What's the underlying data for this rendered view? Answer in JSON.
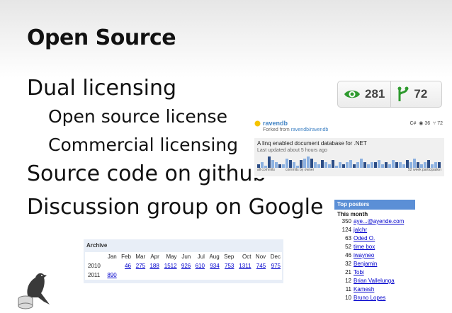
{
  "slide": {
    "title": "Open Source",
    "bullets": [
      {
        "text": "Dual licensing",
        "level": 1
      },
      {
        "text": "Open source license",
        "level": 2
      },
      {
        "text": "Commercial licensing",
        "level": 2
      },
      {
        "text": "Source code on github",
        "level": 1
      },
      {
        "text": "Discussion group on Google",
        "level": 1
      }
    ]
  },
  "badge": {
    "watchers": "281",
    "forks": "72",
    "watch_icon": "eye-icon",
    "fork_icon": "fork-icon",
    "accent": "#2e9a2e"
  },
  "repo": {
    "name": "ravendb",
    "forked_prefix": "Forked from ",
    "forked_from": "ravendb/ravendb",
    "lang": "C#",
    "watchers": "36",
    "forks": "72",
    "description": "A linq enabled document database for .NET",
    "updated": "Last updated about 5 hours ago",
    "graph_left": "all commits",
    "graph_mid": "commits by owner",
    "graph_right": "52 week participation",
    "participation": [
      2,
      3,
      1,
      6,
      4,
      3,
      2,
      2,
      5,
      4,
      3,
      1,
      4,
      5,
      6,
      5,
      3,
      2,
      4,
      3,
      2,
      4,
      1,
      3,
      2,
      3,
      4,
      2,
      3,
      5,
      3,
      2,
      3,
      3,
      4,
      2,
      3,
      2,
      4,
      3,
      3,
      2,
      4,
      3,
      5,
      3,
      2,
      3,
      4,
      2,
      3,
      3
    ]
  },
  "top_posters": {
    "header": "Top posters",
    "subheader": "This month",
    "rows": [
      {
        "count": "350",
        "name": "aye...@ayende.com"
      },
      {
        "count": "124",
        "name": "jalchr"
      },
      {
        "count": "63",
        "name": "Oded O."
      },
      {
        "count": "52",
        "name": "time box"
      },
      {
        "count": "46",
        "name": "iwayneo"
      },
      {
        "count": "32",
        "name": "Benjamin"
      },
      {
        "count": "21",
        "name": "Tobi"
      },
      {
        "count": "12",
        "name": "Brian Vallelunga"
      },
      {
        "count": "11",
        "name": "Kamesh"
      },
      {
        "count": "10",
        "name": "Bruno Lopes"
      }
    ]
  },
  "archive": {
    "header": "Archive",
    "months": [
      "Jan",
      "Feb",
      "Mar",
      "Apr",
      "May",
      "Jun",
      "Jul",
      "Aug",
      "Sep",
      "Oct",
      "Nov",
      "Dec"
    ],
    "years": [
      {
        "year": "2010",
        "counts": [
          "",
          "46",
          "275",
          "188",
          "1512",
          "926",
          "610",
          "934",
          "753",
          "1311",
          "745",
          "975"
        ]
      },
      {
        "year": "2011",
        "counts": [
          "890",
          "",
          "",
          "",
          "",
          "",
          "",
          "",
          "",
          "",
          "",
          ""
        ]
      }
    ]
  },
  "logo_icon": "raven-database-icon"
}
